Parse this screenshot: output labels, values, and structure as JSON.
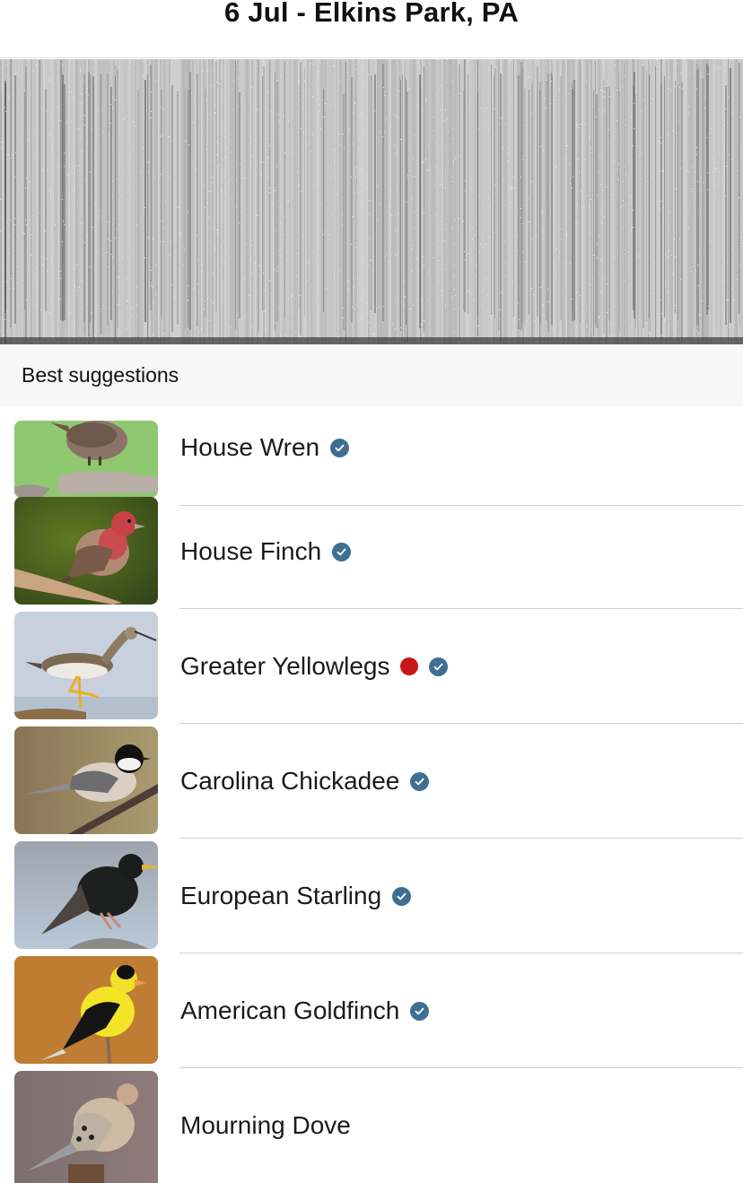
{
  "header": {
    "title": "6 Jul - Elkins Park, PA"
  },
  "spectrogram": {
    "label": "recording spectrogram"
  },
  "section": {
    "title": "Best suggestions"
  },
  "colors": {
    "check_badge": "#3e6f93",
    "rare_dot": "#c8171b",
    "separator": "#cfcfcf",
    "section_bg": "#f7f7f7"
  },
  "suggestions": [
    {
      "name": "House Wren",
      "verified": true,
      "rare": false,
      "photo": "house-wren-photo"
    },
    {
      "name": "House Finch",
      "verified": true,
      "rare": false,
      "photo": "house-finch-photo"
    },
    {
      "name": "Greater Yellowlegs",
      "verified": true,
      "rare": true,
      "photo": "greater-yellowlegs-photo"
    },
    {
      "name": "Carolina Chickadee",
      "verified": true,
      "rare": false,
      "photo": "carolina-chickadee-photo"
    },
    {
      "name": "European Starling",
      "verified": true,
      "rare": false,
      "photo": "european-starling-photo"
    },
    {
      "name": "American Goldfinch",
      "verified": true,
      "rare": false,
      "photo": "american-goldfinch-photo"
    },
    {
      "name": "Mourning Dove",
      "verified": false,
      "rare": false,
      "photo": "mourning-dove-photo"
    }
  ]
}
